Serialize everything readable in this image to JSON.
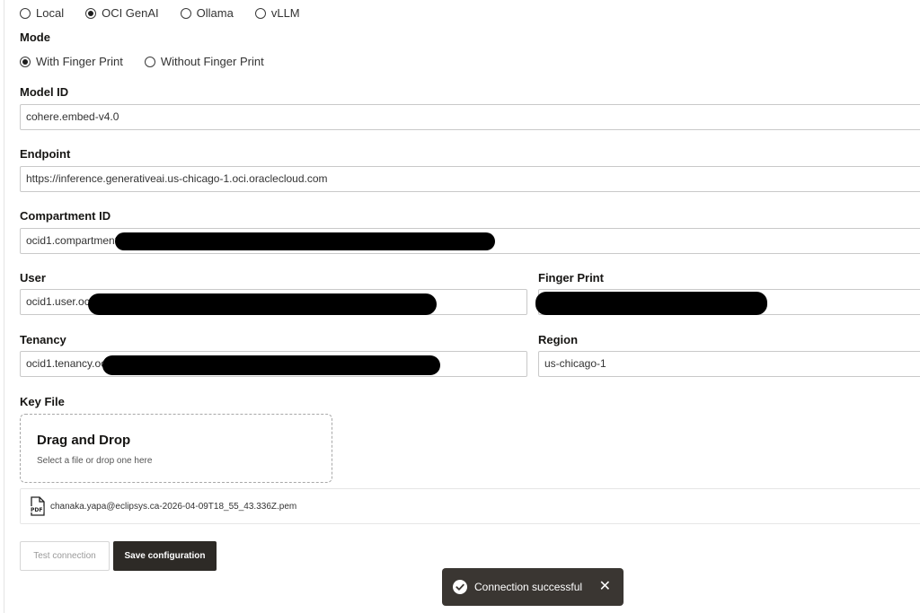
{
  "provider": {
    "options": [
      {
        "label": "Local",
        "selected": false
      },
      {
        "label": "OCI GenAI",
        "selected": true
      },
      {
        "label": "Ollama",
        "selected": false
      },
      {
        "label": "vLLM",
        "selected": false
      }
    ]
  },
  "mode": {
    "label": "Mode",
    "options": [
      {
        "label": "With Finger Print",
        "selected": true
      },
      {
        "label": "Without Finger Print",
        "selected": false
      }
    ]
  },
  "fields": {
    "model_id": {
      "label": "Model ID",
      "value": "cohere.embed-v4.0"
    },
    "endpoint": {
      "label": "Endpoint",
      "value": "https://inference.generativeai.us-chicago-1.oci.oraclecloud.com"
    },
    "compartment_id": {
      "label": "Compartment ID",
      "value": "ocid1.compartment"
    },
    "user": {
      "label": "User",
      "value": "ocid1.user.oc"
    },
    "finger_print": {
      "label": "Finger Print",
      "value": ""
    },
    "tenancy": {
      "label": "Tenancy",
      "value": "ocid1.tenancy.oc"
    },
    "region": {
      "label": "Region",
      "value": "us-chicago-1"
    }
  },
  "key_file": {
    "label": "Key File",
    "drop_title": "Drag and Drop",
    "drop_subtitle": "Select a file or drop one here",
    "file_icon": "pdf-file-icon",
    "file_name": "chanaka.yapa@eclipsys.ca-2026-04-09T18_55_43.336Z.pem"
  },
  "buttons": {
    "test": "Test connection",
    "save": "Save configuration"
  },
  "toast": {
    "message": "Connection successful",
    "icon": "check-circle-icon",
    "close_icon": "close-icon"
  }
}
